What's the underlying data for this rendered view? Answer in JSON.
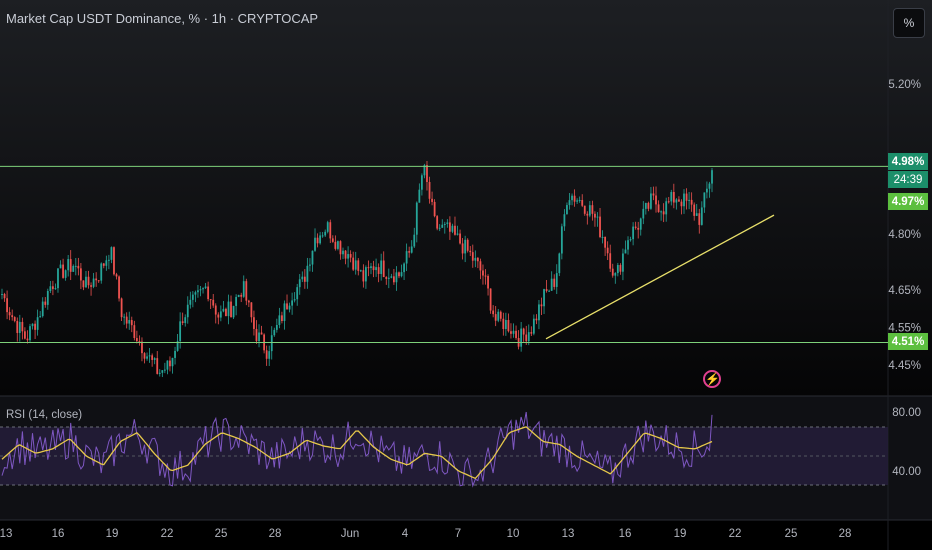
{
  "header": {
    "title": "Market Cap USDT Dominance, % · 1h · CRYPTOCAP",
    "scale_button": "%"
  },
  "price_boxes": {
    "resistance": "4.98%",
    "countdown": "24:39",
    "last": "4.97%",
    "support": "4.51%"
  },
  "rsi": {
    "label": "RSI (14, close)"
  },
  "colors": {
    "up": "#26a69a",
    "down": "#ef5350",
    "level_line": "#7ed17a",
    "trend_line": "#e8df6a",
    "rsi_line": "#7e57c2",
    "rsi_ma": "#e6c84a",
    "rsi_band": "#2a2141"
  },
  "chart_data": [
    {
      "type": "candlestick",
      "title": "Market Cap USDT Dominance, % · 1h · CRYPTOCAP",
      "ylim": [
        4.4,
        5.3
      ],
      "y_ticks": [
        5.2,
        4.8,
        4.65,
        4.55,
        4.45
      ],
      "y_tick_labels": [
        "5.20%",
        "4.80%",
        "4.65%",
        "4.55%",
        "4.45%"
      ],
      "x_tick_labels": [
        "13",
        "16",
        "19",
        "22",
        "25",
        "28",
        "Jun",
        "4",
        "7",
        "10",
        "13",
        "16",
        "19",
        "22",
        "25",
        "28"
      ],
      "horizontal_levels": [
        4.98,
        4.51
      ],
      "trend_line": {
        "from_x_label": "11",
        "from_y": 4.52,
        "to_x_label": "24",
        "to_y": 4.85
      },
      "series_close_path": [
        4.64,
        4.57,
        4.52,
        4.58,
        4.66,
        4.7,
        4.72,
        4.66,
        4.69,
        4.76,
        4.58,
        4.54,
        4.48,
        4.43,
        4.45,
        4.58,
        4.62,
        4.66,
        4.58,
        4.6,
        4.66,
        4.54,
        4.49,
        4.56,
        4.64,
        4.67,
        4.79,
        4.82,
        4.77,
        4.74,
        4.68,
        4.72,
        4.7,
        4.69,
        4.76,
        4.98,
        4.82,
        4.81,
        4.78,
        4.74,
        4.69,
        4.57,
        4.56,
        4.52,
        4.55,
        4.63,
        4.68,
        4.91,
        4.89,
        4.86,
        4.79,
        4.68,
        4.79,
        4.83,
        4.89,
        4.87,
        4.9,
        4.88,
        4.84,
        4.97
      ],
      "last_value": 4.97
    },
    {
      "type": "line",
      "title": "RSI (14, close)",
      "ylim": [
        30,
        90
      ],
      "y_tick_labels": [
        "80.00",
        "40.00"
      ],
      "band": [
        30,
        70
      ],
      "mid": 50,
      "rsi_ma_path": [
        48,
        58,
        52,
        55,
        62,
        50,
        44,
        60,
        66,
        52,
        40,
        44,
        58,
        66,
        62,
        56,
        48,
        52,
        61,
        57,
        55,
        68,
        56,
        48,
        44,
        52,
        50,
        40,
        35,
        48,
        66,
        70,
        60,
        58,
        50,
        44,
        38,
        52,
        66,
        62,
        56,
        55,
        60
      ]
    }
  ]
}
